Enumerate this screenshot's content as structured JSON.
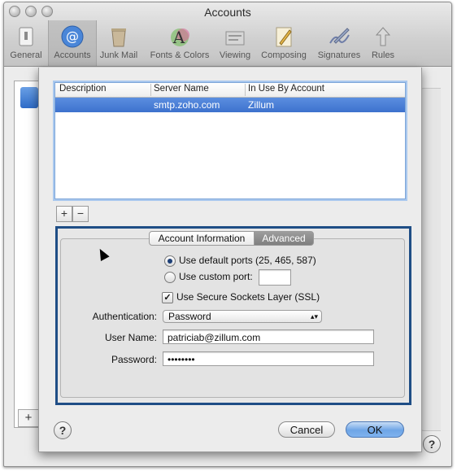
{
  "window": {
    "title": "Accounts"
  },
  "toolbar": {
    "items": [
      {
        "label": "General",
        "icon": "general-switch-icon"
      },
      {
        "label": "Accounts",
        "icon": "at-sign-icon"
      },
      {
        "label": "Junk Mail",
        "icon": "trash-bin-icon"
      },
      {
        "label": "Fonts & Colors",
        "icon": "fonts-colors-icon"
      },
      {
        "label": "Viewing",
        "icon": "viewing-icon"
      },
      {
        "label": "Composing",
        "icon": "pencil-paper-icon"
      },
      {
        "label": "Signatures",
        "icon": "signature-pen-icon"
      },
      {
        "label": "Rules",
        "icon": "rules-arrows-icon"
      }
    ],
    "selected": "Accounts"
  },
  "server_table": {
    "headers": [
      "Description",
      "Server Name",
      "In Use By Account"
    ],
    "rows": [
      {
        "description": "",
        "server_name": "smtp.zoho.com",
        "in_use_by": "Zillum"
      }
    ]
  },
  "table_controls": {
    "add": "+",
    "remove": "−"
  },
  "tabs": {
    "account_information": "Account Information",
    "advanced": "Advanced",
    "selected": "Advanced"
  },
  "ports": {
    "default_label": "Use default ports (25, 465, 587)",
    "custom_label": "Use custom port:",
    "custom_value": "",
    "selected": "default"
  },
  "ssl": {
    "label": "Use Secure Sockets Layer (SSL)",
    "checked": true
  },
  "authentication": {
    "label": "Authentication:",
    "value": "Password"
  },
  "user_name": {
    "label": "User Name:",
    "value": "patriciab@zillum.com"
  },
  "password": {
    "label": "Password:",
    "value": "••••••••"
  },
  "buttons": {
    "cancel": "Cancel",
    "ok": "OK",
    "help": "?"
  },
  "background": {
    "add": "+",
    "help": "?"
  },
  "colors": {
    "selection": "#3d72cd",
    "focus_border": "#1f4e86",
    "ok_button": "#6ea5e6"
  }
}
